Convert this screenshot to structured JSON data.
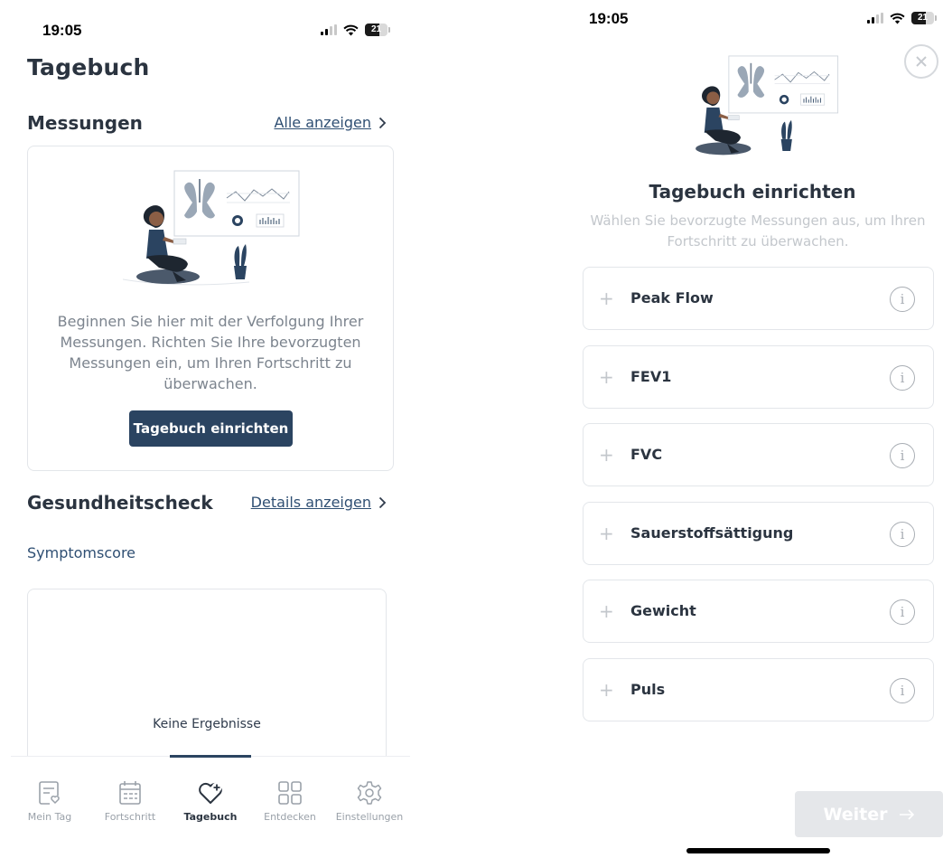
{
  "colors": {
    "primary": "#2b4461",
    "link": "#2f4f73",
    "muted_text": "#7c848e",
    "disabled": "#e5e7ea"
  },
  "left": {
    "status": {
      "time": "19:05",
      "battery": "21"
    },
    "page_title": "Tagebuch",
    "measurements": {
      "title": "Messungen",
      "link": "Alle anzeigen",
      "empty_text": "Beginnen Sie hier mit der Verfolgung Ihrer Messungen. Richten Sie Ihre bevorzugten Messungen ein, um Ihren Fortschritt zu überwachen.",
      "button": "Tagebuch einrichten"
    },
    "health": {
      "title": "Gesundheitscheck",
      "link": "Details anzeigen",
      "subtitle": "Symptomscore",
      "empty": "Keine Ergebnisse"
    },
    "tabs": [
      {
        "label": "Mein Tag",
        "icon": "calendar-heart-icon"
      },
      {
        "label": "Fortschritt",
        "icon": "calendar-grid-icon"
      },
      {
        "label": "Tagebuch",
        "icon": "heart-plus-icon",
        "active": true
      },
      {
        "label": "Entdecken",
        "icon": "grid-icon"
      },
      {
        "label": "Einstellungen",
        "icon": "gear-icon"
      }
    ]
  },
  "right": {
    "status": {
      "time": "19:05",
      "battery": "21"
    },
    "title": "Tagebuch einrichten",
    "subtitle": "Wählen Sie bevorzugte Messungen aus, um Ihren Fortschritt zu überwachen.",
    "measurements": [
      {
        "label": "Peak Flow"
      },
      {
        "label": "FEV1"
      },
      {
        "label": "FVC"
      },
      {
        "label": "Sauerstoffsättigung"
      },
      {
        "label": "Gewicht"
      },
      {
        "label": "Puls"
      }
    ],
    "next_button": "Weiter"
  }
}
